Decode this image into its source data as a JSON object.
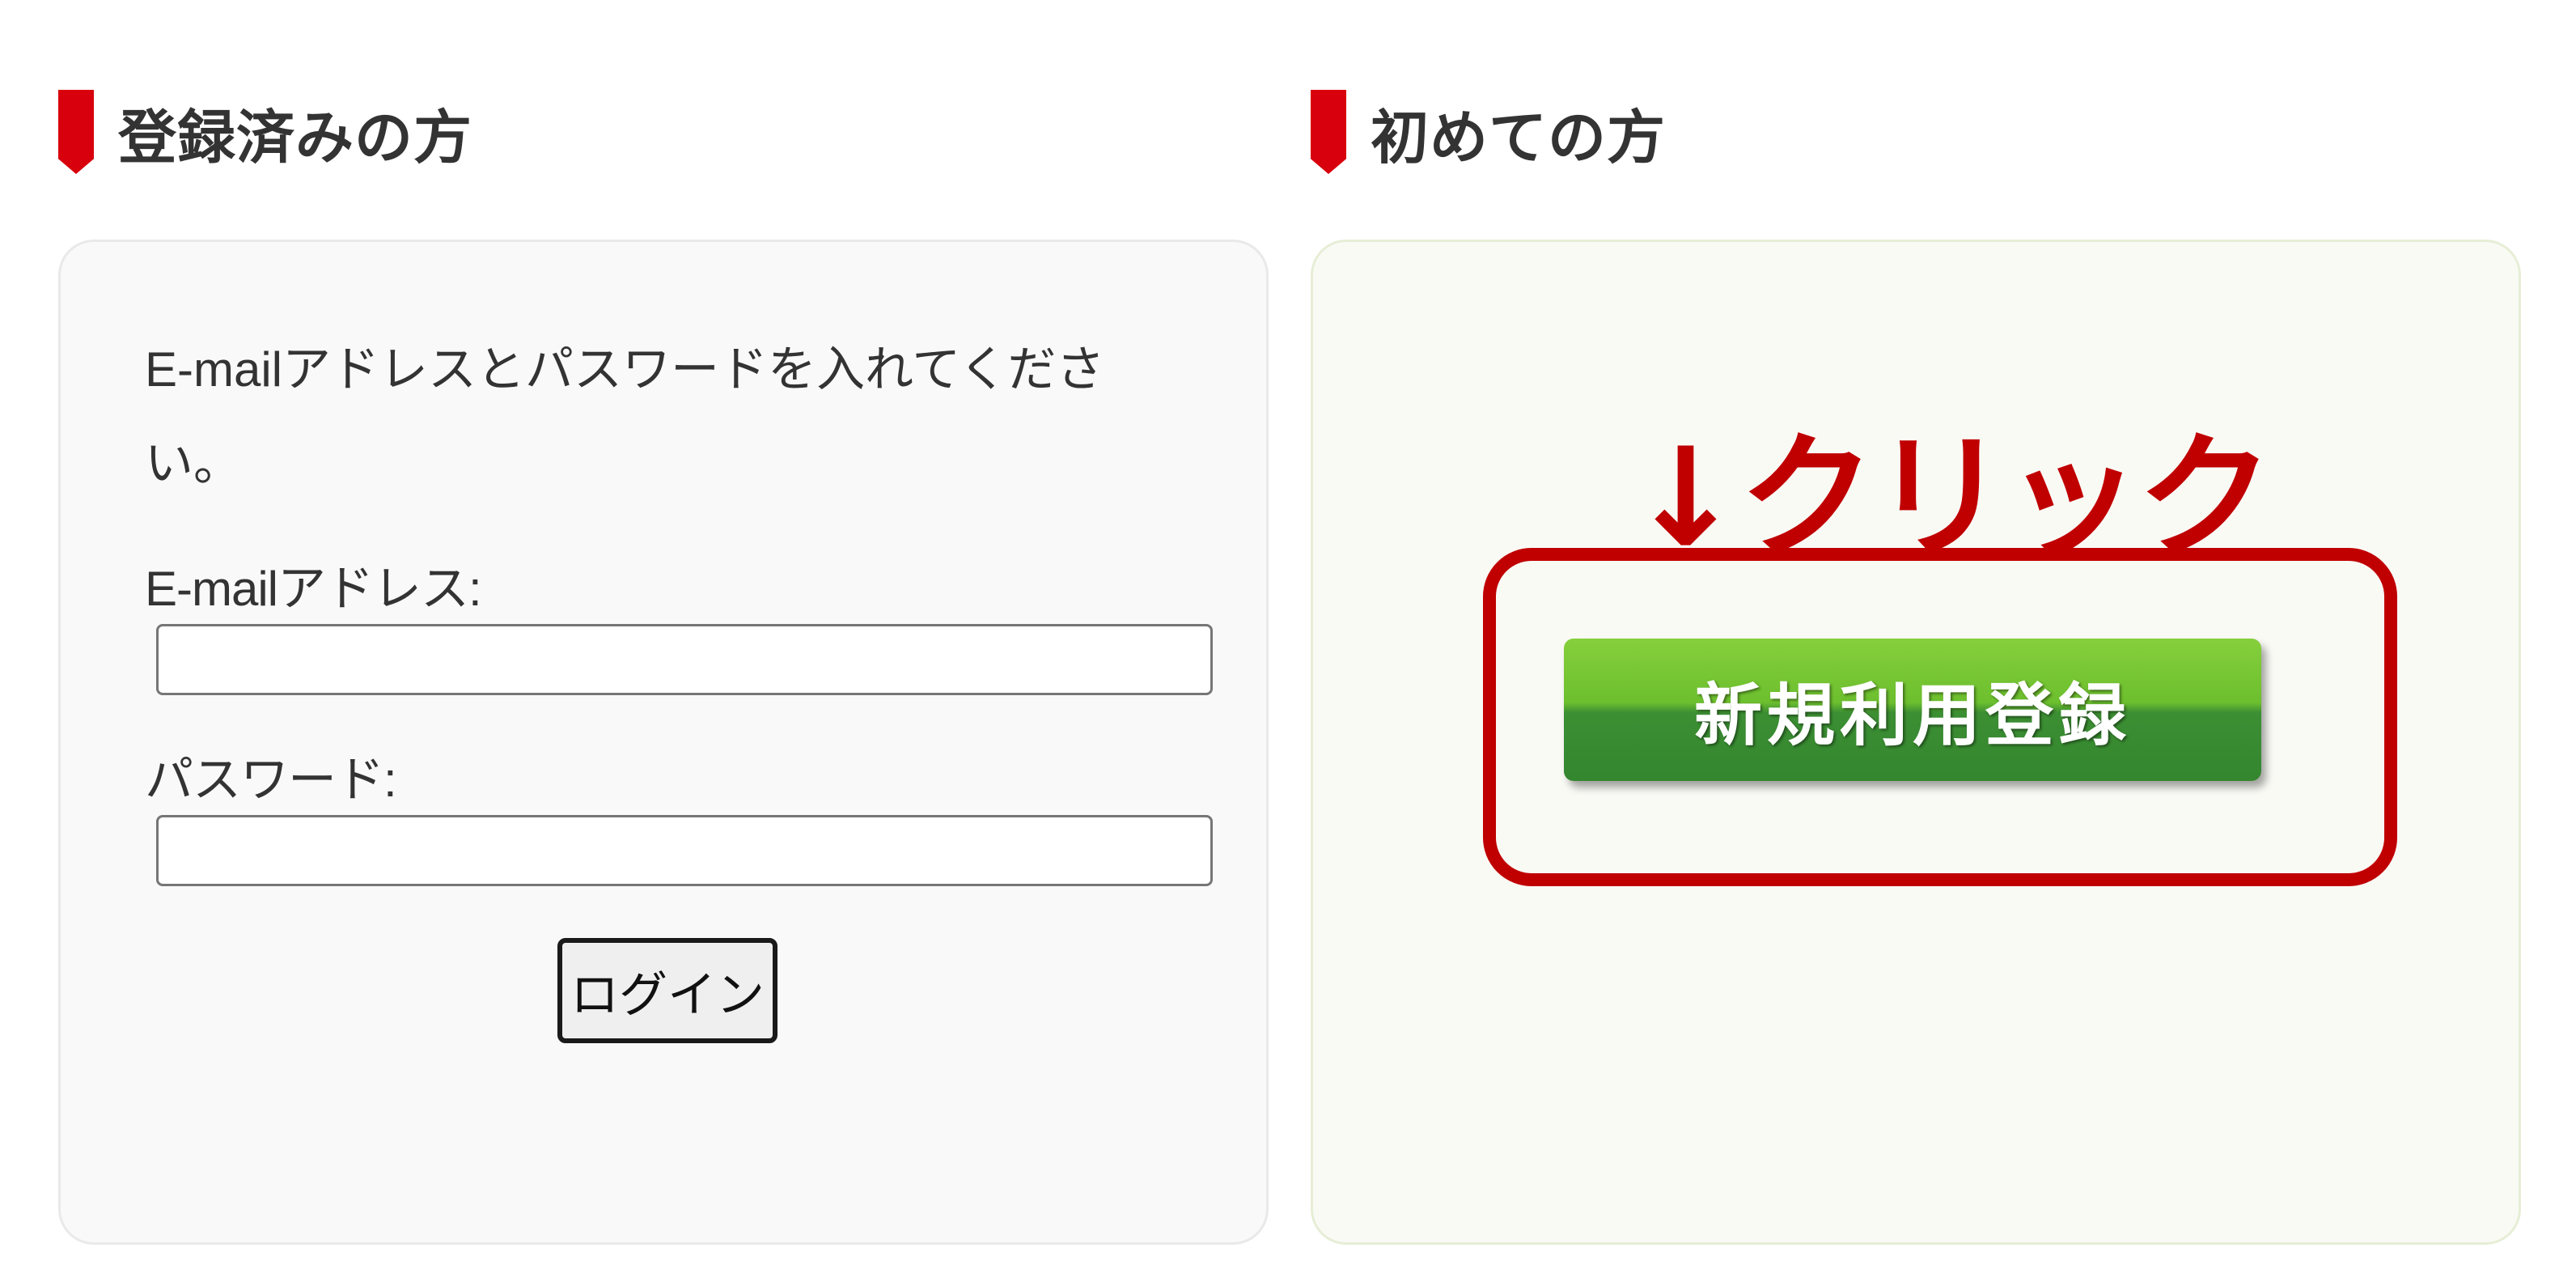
{
  "registered": {
    "heading": "登録済みの方",
    "instructions": "E-mailアドレスとパスワードを入れてください。",
    "email_label": "E-mailアドレス:",
    "email_value": "",
    "password_label": "パスワード:",
    "password_value": "",
    "login_label": "ログイン"
  },
  "new_user": {
    "heading": "初めての方",
    "annotation": "↓クリック",
    "register_label": "新規利用登録"
  },
  "colors": {
    "accent_red": "#d8000c",
    "annotation_red": "#c00000",
    "register_green": "#5cb030"
  }
}
